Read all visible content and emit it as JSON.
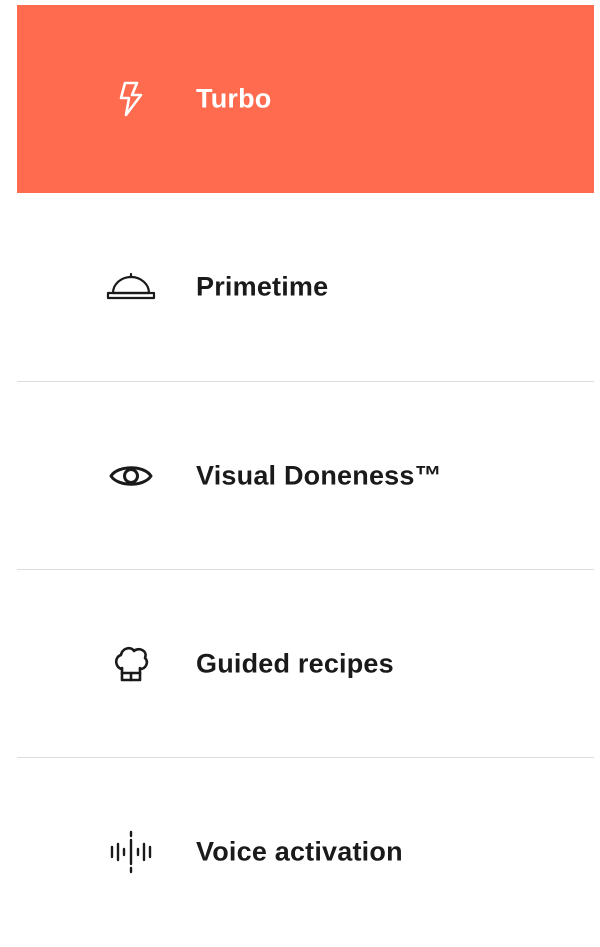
{
  "colors": {
    "active_background": "#ff6b4f",
    "active_text": "#ffffff",
    "text": "#1a1a1a",
    "divider": "#dedede"
  },
  "menu": {
    "items": [
      {
        "label": "Turbo",
        "icon": "lightning-bolt-icon",
        "active": true
      },
      {
        "label": "Primetime",
        "icon": "serving-cloche-icon",
        "active": false
      },
      {
        "label": "Visual Doneness™",
        "icon": "eye-icon",
        "active": false
      },
      {
        "label": "Guided recipes",
        "icon": "chef-hat-icon",
        "active": false
      },
      {
        "label": "Voice activation",
        "icon": "sound-wave-icon",
        "active": false
      }
    ]
  }
}
